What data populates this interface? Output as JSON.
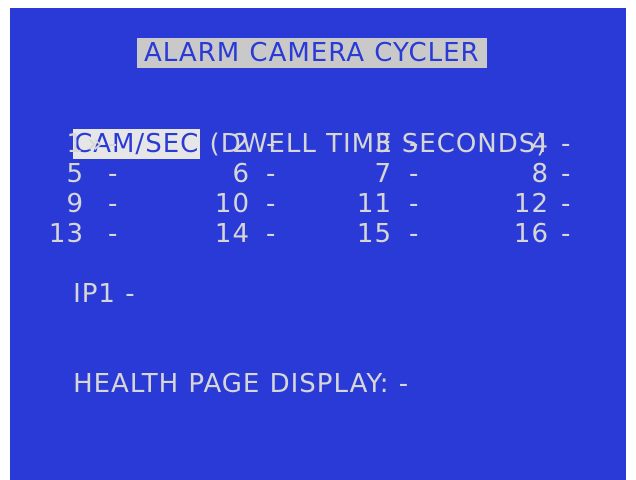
{
  "title": "ALARM CAMERA CYCLER",
  "header": {
    "selected": "CAM/SEC",
    "caption": "(DWELL TIME SECONDS)"
  },
  "cameras": [
    {
      "label": "1",
      "marker": "»",
      "value": "-"
    },
    {
      "label": "2",
      "value": "-"
    },
    {
      "label": "3",
      "value": "-"
    },
    {
      "label": "4",
      "value": "-"
    },
    {
      "label": "5",
      "value": "-"
    },
    {
      "label": "6",
      "value": "-"
    },
    {
      "label": "7",
      "value": "-"
    },
    {
      "label": "8",
      "value": "-"
    },
    {
      "label": "9",
      "value": "-"
    },
    {
      "label": "10",
      "value": "-"
    },
    {
      "label": "11",
      "value": "-"
    },
    {
      "label": "12",
      "value": "-"
    },
    {
      "label": "13",
      "value": "-"
    },
    {
      "label": "14",
      "value": "-"
    },
    {
      "label": "15",
      "value": "-"
    },
    {
      "label": "16",
      "value": "-"
    }
  ],
  "ip": {
    "label": "IP1",
    "value": "-"
  },
  "health": {
    "label": "HEALTH PAGE DISPLAY:",
    "value": "-"
  },
  "colors": {
    "background": "#2a3ad6",
    "text": "#d6d6d6",
    "highlight": "#e6e6e6"
  }
}
